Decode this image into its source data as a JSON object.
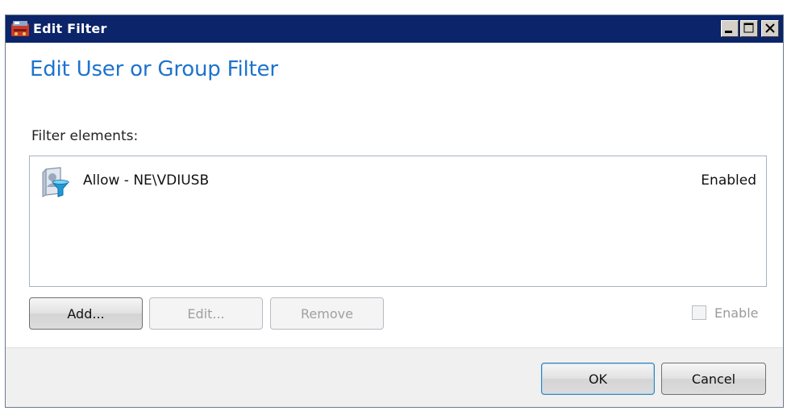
{
  "window": {
    "title": "Edit Filter"
  },
  "dialog": {
    "heading": "Edit User or Group Filter",
    "list_label": "Filter elements:",
    "items": [
      {
        "name": "Allow - NE\\VDIUSB",
        "status": "Enabled",
        "icon": "user-filter-icon"
      }
    ],
    "buttons": {
      "add": "Add...",
      "edit": "Edit...",
      "remove": "Remove",
      "ok": "OK",
      "cancel": "Cancel"
    },
    "enable_checkbox": {
      "label": "Enable",
      "checked": false,
      "disabled": true
    }
  },
  "colors": {
    "titlebar": "#0b246a",
    "heading": "#1e73cd",
    "footer": "#f0f0f0"
  }
}
